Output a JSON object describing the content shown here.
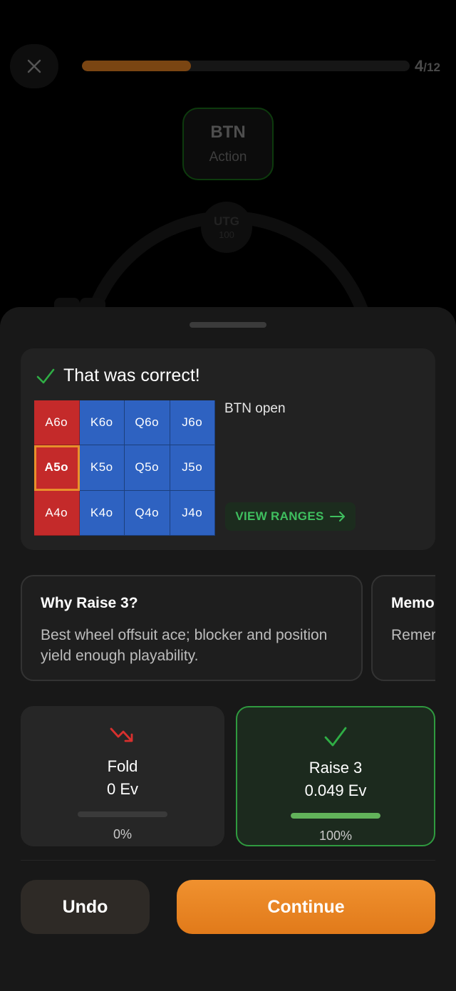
{
  "header": {
    "progress_current": "4",
    "progress_separator": "/",
    "progress_total": "12",
    "progress_fraction": 0.333
  },
  "table": {
    "hero_seat": {
      "position": "BTN",
      "status": "Action"
    },
    "utg_seat": {
      "position": "UTG",
      "stack": "100"
    }
  },
  "result": {
    "title": "That was correct!",
    "range_name": "BTN open",
    "view_ranges_label": "VIEW RANGES",
    "grid": [
      [
        {
          "hand": "A6o",
          "action": "raise"
        },
        {
          "hand": "K6o",
          "action": "fold"
        },
        {
          "hand": "Q6o",
          "action": "fold"
        },
        {
          "hand": "J6o",
          "action": "fold"
        }
      ],
      [
        {
          "hand": "A5o",
          "action": "raise",
          "current": true
        },
        {
          "hand": "K5o",
          "action": "fold"
        },
        {
          "hand": "Q5o",
          "action": "fold"
        },
        {
          "hand": "J5o",
          "action": "fold"
        }
      ],
      [
        {
          "hand": "A4o",
          "action": "raise"
        },
        {
          "hand": "K4o",
          "action": "fold"
        },
        {
          "hand": "Q4o",
          "action": "fold"
        },
        {
          "hand": "J4o",
          "action": "fold"
        }
      ]
    ],
    "colors": {
      "raise": "#c42a2a",
      "fold": "#2e62c1",
      "highlight": "#e9902b"
    }
  },
  "explanations": [
    {
      "title": "Why Raise 3?",
      "body": "Best wheel offsuit ace; blocker and position yield enough playability."
    },
    {
      "title": "Memo",
      "body": "Remer begins"
    }
  ],
  "options": [
    {
      "label": "Fold",
      "ev": "0 Ev",
      "frequency": "0%",
      "frequency_value": 0,
      "icon": "trend-down-icon"
    },
    {
      "label": "Raise 3",
      "ev": "0.049 Ev",
      "frequency": "100%",
      "frequency_value": 1,
      "icon": "check-icon"
    }
  ],
  "footer": {
    "undo_label": "Undo",
    "continue_label": "Continue"
  }
}
